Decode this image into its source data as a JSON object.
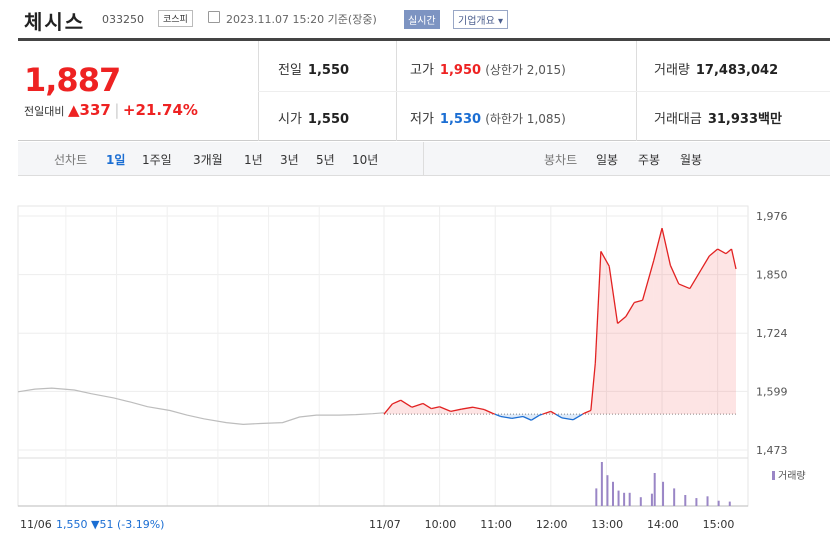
{
  "header": {
    "stock_name": "체시스",
    "stock_code": "033250",
    "market_badge": "코스피",
    "calendar_icon": "calendar-icon",
    "datetime": "2023.11.07 15:20 기준(장중)",
    "realtime_badge": "실시간",
    "company_info_button": "기업개요 ▾"
  },
  "quote": {
    "current_price": "1,887",
    "change_label": "전일대비",
    "change_arrow": "▲",
    "change_amount": "337",
    "change_percent": "+21.74%",
    "prev_close_label": "전일",
    "prev_close": "1,550",
    "open_label": "시가",
    "open": "1,550",
    "high_label": "고가",
    "high": "1,950",
    "upper_limit": "(상한가 2,015)",
    "low_label": "저가",
    "low": "1,530",
    "lower_limit": "(하한가 1,085)",
    "volume_label": "거래량",
    "volume": "17,483,042",
    "amount_label": "거래대금",
    "amount": "31,933",
    "amount_unit": "백만"
  },
  "period_tabs": {
    "line_chart_label": "선차트",
    "items": [
      "1일",
      "1주일",
      "3개월",
      "1년",
      "3년",
      "5년",
      "10년"
    ],
    "selected": "1일",
    "candle_chart_label": "봉차트",
    "candle_items": [
      "일봉",
      "주봉",
      "월봉"
    ]
  },
  "colors": {
    "up": "#e22222",
    "down": "#1b6ed3",
    "volume": "#9a86c6",
    "prev_day_line": "#bdbdbd"
  },
  "chart_data": {
    "type": "line",
    "title": "",
    "y_ticks": [
      "1,976",
      "1,850",
      "1,724",
      "1,599",
      "1,473"
    ],
    "ylim": [
      1473,
      1976
    ],
    "baseline": 1550,
    "x_ticks": [
      "11/07",
      "10:00",
      "11:00",
      "12:00",
      "13:00",
      "14:00",
      "15:00"
    ],
    "prev_day_label": "11/06",
    "prev_day_summary": "1,550 ▼51 (-3.19%)",
    "volume_legend": "거래량",
    "series": [
      {
        "name": "",
        "note": "previous day (11/06) intraday, gray",
        "times": [
          0,
          0.3,
          0.6,
          1,
          1.3,
          1.7,
          2,
          2.3,
          2.7,
          3,
          3.3,
          3.7,
          4,
          4.3,
          4.7,
          5,
          5.3,
          5.7,
          6,
          6.3,
          6.5
        ],
        "values": [
          1598,
          1604,
          1606,
          1602,
          1594,
          1585,
          1576,
          1566,
          1558,
          1548,
          1540,
          1532,
          1528,
          1530,
          1532,
          1544,
          1548,
          1548,
          1549,
          1551,
          1553
        ]
      },
      {
        "name": "",
        "note": "today (11/07) intraday, red above / blue below 1,550",
        "times": [
          9,
          9.15,
          9.3,
          9.5,
          9.7,
          9.85,
          10,
          10.2,
          10.4,
          10.6,
          10.8,
          10.95,
          11.1,
          11.3,
          11.5,
          11.65,
          11.8,
          12,
          12.2,
          12.4,
          12.6,
          12.72,
          12.8,
          12.9,
          13.05,
          13.2,
          13.35,
          13.5,
          13.65,
          13.85,
          14,
          14.15,
          14.3,
          14.5,
          14.7,
          14.85,
          15,
          15.15,
          15.25,
          15.33
        ],
        "values": [
          1550,
          1572,
          1580,
          1565,
          1573,
          1562,
          1566,
          1556,
          1561,
          1565,
          1560,
          1552,
          1545,
          1541,
          1545,
          1537,
          1548,
          1556,
          1542,
          1538,
          1552,
          1558,
          1660,
          1900,
          1868,
          1745,
          1760,
          1790,
          1795,
          1880,
          1950,
          1870,
          1830,
          1820,
          1860,
          1890,
          1905,
          1895,
          1905,
          1862
        ]
      }
    ],
    "volume": {
      "name": "거래량",
      "times": [
        12.8,
        12.9,
        13.0,
        13.1,
        13.2,
        13.3,
        13.4,
        13.6,
        13.8,
        13.85,
        14.0,
        14.2,
        14.4,
        14.6,
        14.8,
        15.0,
        15.2
      ],
      "values": [
        40,
        100,
        70,
        55,
        35,
        30,
        30,
        20,
        28,
        75,
        55,
        40,
        25,
        18,
        22,
        12,
        10
      ]
    }
  }
}
